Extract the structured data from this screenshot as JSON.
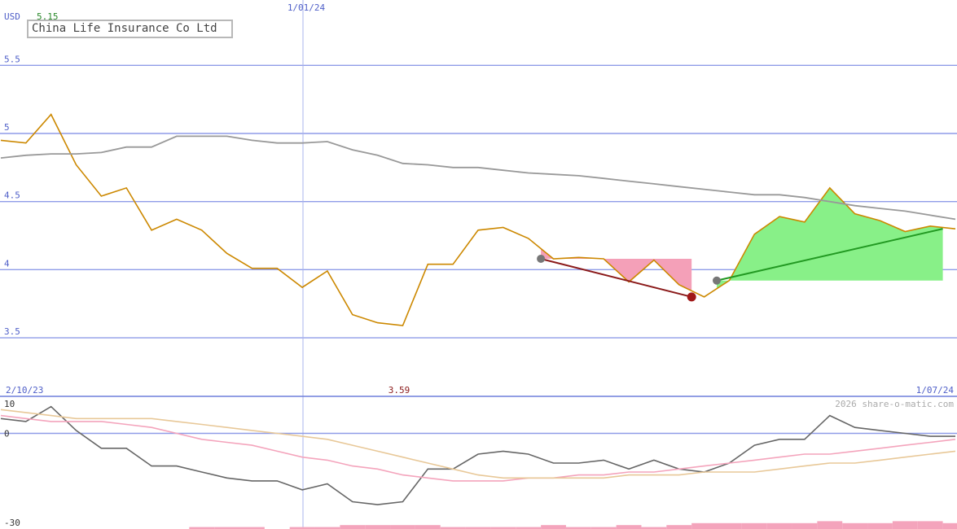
{
  "chart_data": [
    {
      "type": "line",
      "title": "China Life Insurance Co Ltd",
      "currency": "USD",
      "last_price_label": "5.15",
      "x_start_label": "2/10/23",
      "x_mid_label": "1/01/24",
      "x_end_label": "1/07/24",
      "min_marker_label": "3.59",
      "ylim": [
        3.07,
        5.98
      ],
      "yticks": [
        "5.5",
        "5",
        "4.5",
        "4",
        "3.5"
      ],
      "ytick_values": [
        5.5,
        5.0,
        4.5,
        4.0,
        3.5
      ],
      "series": [
        {
          "key": "price",
          "color": "#cc8800",
          "values": [
            4.95,
            4.93,
            5.14,
            4.77,
            4.54,
            4.6,
            4.29,
            4.37,
            4.29,
            4.12,
            4.01,
            4.01,
            3.87,
            3.99,
            3.67,
            3.61,
            3.59,
            4.04,
            4.04,
            4.29,
            4.31,
            4.23,
            4.08,
            4.09,
            4.08,
            3.91,
            4.07,
            3.89,
            3.8,
            3.92,
            4.26,
            4.39,
            4.35,
            4.6,
            4.41,
            4.36,
            4.28,
            4.32,
            4.3
          ]
        },
        {
          "key": "moving-average",
          "color": "#999999",
          "values": [
            4.82,
            4.84,
            4.85,
            4.85,
            4.86,
            4.9,
            4.9,
            4.98,
            4.98,
            4.98,
            4.95,
            4.93,
            4.93,
            4.94,
            4.88,
            4.84,
            4.78,
            4.77,
            4.75,
            4.75,
            4.73,
            4.71,
            4.7,
            4.69,
            4.67,
            4.65,
            4.63,
            4.61,
            4.59,
            4.57,
            4.55,
            4.55,
            4.53,
            4.5,
            4.47,
            4.45,
            4.43,
            4.4,
            4.37
          ]
        }
      ],
      "patterns": [
        {
          "type": "decline",
          "from": {
            "index": 21.5,
            "value": 4.08
          },
          "to": {
            "index": 27.5,
            "value": 3.8
          },
          "fill": "#f4a0b8",
          "line": "#8b1a1a",
          "top_value": 4.08
        },
        {
          "type": "advance",
          "from": {
            "index": 28.5,
            "value": 3.92
          },
          "to": {
            "index": 37.5,
            "value": 4.3
          },
          "fill": "#88f088",
          "line": "#229922",
          "base_value": 3.92
        }
      ],
      "grid": true
    },
    {
      "type": "line",
      "ylim": [
        -30,
        10
      ],
      "yticks": [
        "10",
        "0",
        "-30"
      ],
      "ytick_values": [
        10,
        0,
        -30
      ],
      "series": [
        {
          "key": "momentum",
          "color": "#666666",
          "values": [
            5,
            4,
            9,
            1,
            -5,
            -5,
            -11,
            -11,
            -13,
            -15,
            -16,
            -16,
            -19,
            -17,
            -23,
            -24,
            -23,
            -12,
            -12,
            -7,
            -6,
            -7,
            -10,
            -10,
            -9,
            -12,
            -9,
            -12,
            -13,
            -10,
            -4,
            -2,
            -2,
            6,
            2,
            1,
            0,
            -1,
            -1
          ]
        },
        {
          "key": "slow-average",
          "color": "#f4a4bc",
          "values": [
            6,
            5,
            4,
            4,
            4,
            3,
            2,
            0,
            -2,
            -3,
            -4,
            -6,
            -8,
            -9,
            -11,
            -12,
            -14,
            -15,
            -16,
            -16,
            -16,
            -15,
            -15,
            -14,
            -14,
            -13,
            -13,
            -12,
            -11,
            -10,
            -9,
            -8,
            -7,
            -7,
            -6,
            -5,
            -4,
            -3,
            -2
          ]
        },
        {
          "key": "fast-average",
          "color": "#e8c898",
          "values": [
            8,
            7,
            6,
            5,
            5,
            5,
            5,
            4,
            3,
            2,
            1,
            0,
            -1,
            -2,
            -4,
            -6,
            -8,
            -10,
            -12,
            -14,
            -15,
            -15,
            -15,
            -15,
            -15,
            -14,
            -14,
            -14,
            -13,
            -13,
            -13,
            -12,
            -11,
            -10,
            -10,
            -9,
            -8,
            -7,
            -6
          ]
        }
      ],
      "bars": {
        "color": "#f4a4bc",
        "values": [
          0,
          0,
          0,
          0,
          0,
          0,
          0,
          0,
          1,
          1,
          1,
          0,
          1,
          1,
          2,
          2,
          2,
          2,
          1,
          1,
          1,
          1,
          2,
          1,
          1,
          2,
          1,
          2,
          3,
          3,
          3,
          3,
          3,
          4,
          3,
          3,
          4,
          4,
          3
        ]
      }
    }
  ],
  "watermark": "2026 share-o-matic.com"
}
